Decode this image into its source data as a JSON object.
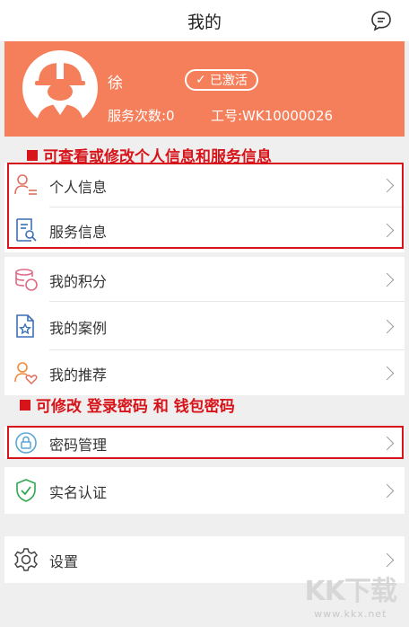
{
  "header": {
    "title": "我的"
  },
  "profile": {
    "name": "徐",
    "badge": "已激活",
    "service_count": "服务次数:0",
    "job_id": "工号:WK10000026"
  },
  "annotations": [
    "可查看或修改个人信息和服务信息",
    "可修改 登录密码 和 钱包密码"
  ],
  "menu": [
    {
      "label": "个人信息",
      "icon": "person-list-icon"
    },
    {
      "label": "服务信息",
      "icon": "doc-search-icon"
    },
    {
      "label": "我的积分",
      "icon": "coins-stack-icon"
    },
    {
      "label": "我的案例",
      "icon": "doc-star-icon"
    },
    {
      "label": "我的推荐",
      "icon": "person-heart-icon"
    },
    {
      "label": "密码管理",
      "icon": "lock-icon"
    },
    {
      "label": "实名认证",
      "icon": "shield-check-icon"
    },
    {
      "label": "设置",
      "icon": "gear-icon"
    }
  ],
  "watermark": {
    "big": "KK下载",
    "small": "www.kkx.net"
  },
  "colors": {
    "accent": "#f67f5b",
    "annotation": "#d6141a"
  }
}
